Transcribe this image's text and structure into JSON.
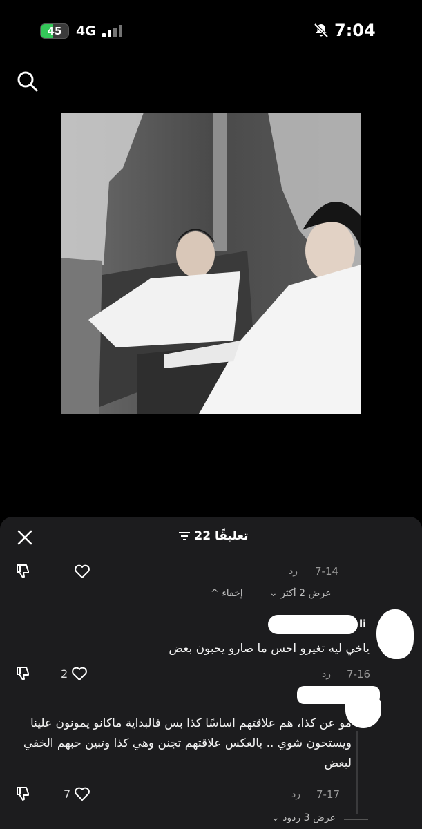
{
  "status": {
    "battery": "45",
    "battery_level_percent": 45,
    "network": "4G",
    "time": "7:04"
  },
  "icons": {
    "search": "search-icon",
    "close": "close-icon",
    "filter": "filter-icon",
    "like": "heart-icon",
    "dislike": "thumbs-down-icon",
    "mute": "bell-slash-icon"
  },
  "comments_sheet": {
    "title": "22 تعليقًا",
    "rows": [
      {
        "date": "7-14",
        "reply": "رد",
        "likes": ""
      },
      {
        "date": "7-16",
        "reply": "رد",
        "likes": "2"
      },
      {
        "date": "7-17",
        "reply": "رد",
        "likes": "7"
      }
    ],
    "view_more": "عرض 2 أكثر",
    "hide": "إخفاء",
    "username_tail": "li",
    "comment_1": "ياخي ليه تغيرو احس ما صارو يحبون بعض",
    "comment_2": "مو عن كذا، هم علاقتهم اساسًا كذا بس فالبداية ماكانو يمونون علينا ويستحون شوي .. بالعكس علاقتهم تجنن وهي كذا وتبين حبهم الخفي لبعض",
    "view_replies": "عرض 3 ردود"
  },
  "colors": {
    "background": "#000000",
    "sheet": "#1c1c1e",
    "battery_green": "#34c759",
    "muted_text": "#9a9a9a"
  }
}
